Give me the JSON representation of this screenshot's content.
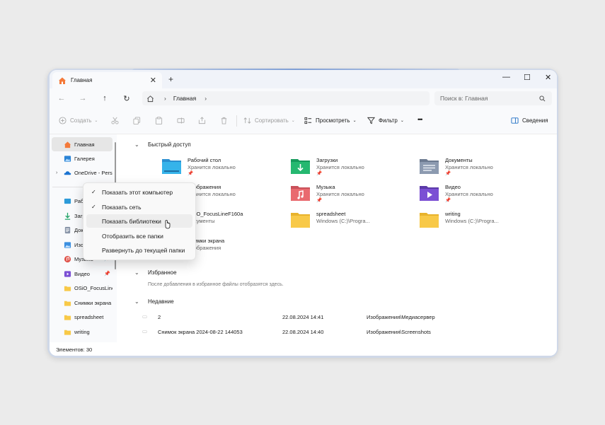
{
  "titlebar": {
    "tab_title": "Главная",
    "close": "✕",
    "new_tab": "+",
    "minimize": "—",
    "maximize": "☐",
    "close_window": "✕"
  },
  "navbar": {
    "breadcrumb": "Главная",
    "separator": "›",
    "search_placeholder": "Поиск в: Главная"
  },
  "toolbar": {
    "create": "Создать",
    "sort": "Сортировать",
    "view": "Просмотреть",
    "filter": "Фильтр",
    "more": "•••",
    "details": "Сведения"
  },
  "sidebar": {
    "items": [
      {
        "label": "Главная"
      },
      {
        "label": "Галерея"
      },
      {
        "label": "OneDrive - Persona"
      },
      {
        "label": "Рабочий стол"
      },
      {
        "label": "Загрузки"
      },
      {
        "label": "Документы"
      },
      {
        "label": "Изображения"
      },
      {
        "label": "Музыка"
      },
      {
        "label": "Видео"
      },
      {
        "label": "OSiO_FocusLineF160a"
      },
      {
        "label": "Снимки экрана"
      },
      {
        "label": "spreadsheet"
      },
      {
        "label": "writing"
      }
    ]
  },
  "main": {
    "quick_access_title": "Быстрый доступ",
    "quick_access": [
      {
        "name": "Рабочий стол",
        "sub": "Хранится локально"
      },
      {
        "name": "Загрузки",
        "sub": "Хранится локально"
      },
      {
        "name": "Документы",
        "sub": "Хранится локально"
      },
      {
        "name": "Изображения",
        "sub": "Хранится локально"
      },
      {
        "name": "Музыка",
        "sub": "Хранится локально"
      },
      {
        "name": "Видео",
        "sub": "Хранится локально"
      },
      {
        "name": "OSiO_FocusLineF160a",
        "sub": "Документы"
      },
      {
        "name": "spreadsheet",
        "sub": "Windows (C:)\\Progra..."
      },
      {
        "name": "writing",
        "sub": "Windows (C:)\\Progra..."
      },
      {
        "name": "Снимки экрана",
        "sub": "Изображения"
      }
    ],
    "favorites_title": "Избранное",
    "favorites_empty": "После добавления в избранное файлы отобразятся здесь.",
    "recent_title": "Недавние",
    "recent": [
      {
        "name": "2",
        "date": "22.08.2024 14:41",
        "location": "Изображения\\Медиасервер"
      },
      {
        "name": "Снимок экрана 2024-08-22 144053",
        "date": "22.08.2024 14:40",
        "location": "Изображения\\Screenshots"
      }
    ]
  },
  "status": {
    "items_count": "Элементов: 30"
  },
  "context_menu": {
    "items": [
      {
        "label": "Показать этот компьютер",
        "checked": true
      },
      {
        "label": "Показать сеть",
        "checked": true
      },
      {
        "label": "Показать библиотеки",
        "checked": false
      },
      {
        "label": "Отобразить все папки",
        "checked": false
      },
      {
        "label": "Развернуть до текущей папки",
        "checked": false
      }
    ]
  },
  "colors": {
    "accent": "#0067c0",
    "folder": "#f8c948",
    "selected": "#e6e6e6"
  }
}
